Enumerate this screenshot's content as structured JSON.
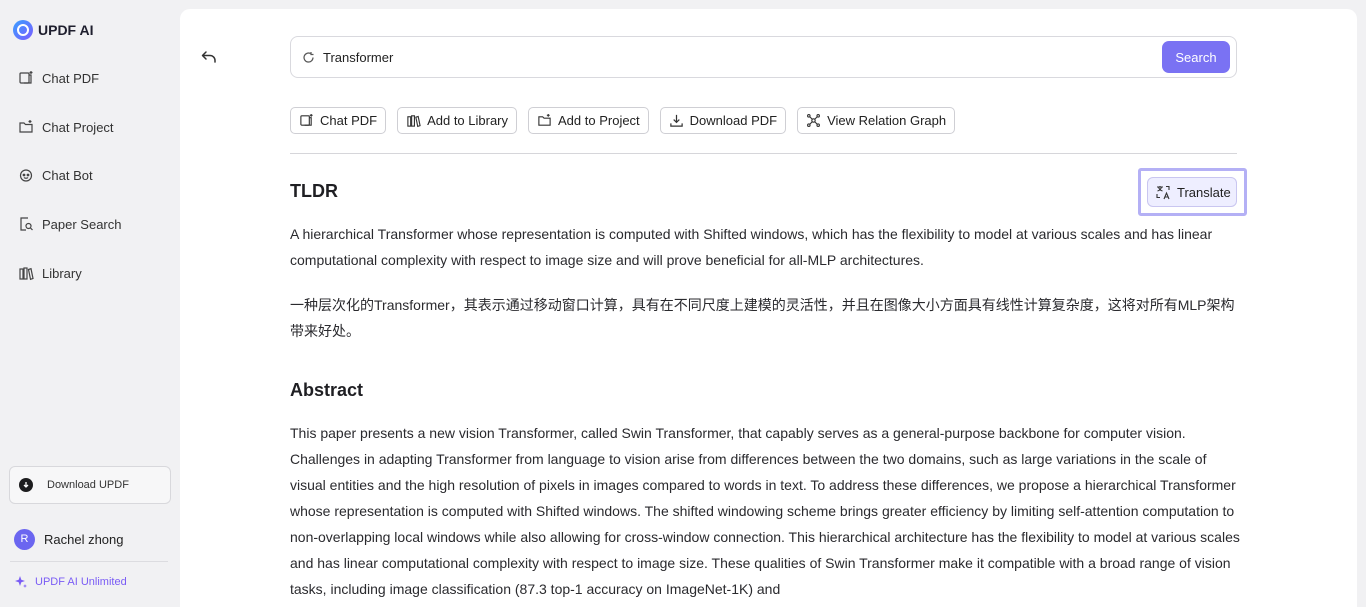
{
  "brand": {
    "name": "UPDF AI"
  },
  "sidebar": {
    "items": [
      {
        "label": "Chat PDF",
        "icon": "chat-pdf-icon"
      },
      {
        "label": "Chat Project",
        "icon": "folder-icon"
      },
      {
        "label": "Chat Bot",
        "icon": "bot-icon"
      },
      {
        "label": "Paper Search",
        "icon": "paper-search-icon"
      },
      {
        "label": "Library",
        "icon": "library-icon"
      }
    ],
    "download_label": "Download UPDF",
    "user": {
      "initial": "R",
      "name": "Rachel zhong"
    },
    "plan_label": "UPDF AI Unlimited"
  },
  "search": {
    "value": "Transformer",
    "button_label": "Search"
  },
  "actions": [
    {
      "label": "Chat PDF",
      "icon": "chat-pdf-icon"
    },
    {
      "label": "Add to Library",
      "icon": "library-icon"
    },
    {
      "label": "Add to Project",
      "icon": "folder-icon"
    },
    {
      "label": "Download PDF",
      "icon": "download-icon"
    },
    {
      "label": "View Relation Graph",
      "icon": "graph-icon"
    }
  ],
  "tldr": {
    "heading": "TLDR",
    "translate_label": "Translate",
    "text_en": "A hierarchical Transformer whose representation is computed with Shifted windows, which has the flexibility to model at various scales and has linear computational complexity with respect to image size and will prove beneficial for all-MLP architectures.",
    "text_zh": "一种层次化的Transformer，其表示通过移动窗口计算，具有在不同尺度上建模的灵活性，并且在图像大小方面具有线性计算复杂度，这将对所有MLP架构带来好处。"
  },
  "abstract": {
    "heading": "Abstract",
    "text": "This paper presents a new vision Transformer, called Swin Transformer, that capably serves as a general-purpose backbone for computer vision. Challenges in adapting Transformer from language to vision arise from differences between the two domains, such as large variations in the scale of visual entities and the high resolution of pixels in images compared to words in text. To address these differences, we propose a hierarchical Transformer whose representation is computed with Shifted windows. The shifted windowing scheme brings greater efficiency by limiting self-attention computation to non-overlapping local windows while also allowing for cross-window connection. This hierarchical architecture has the flexibility to model at various scales and has linear computational complexity with respect to image size. These qualities of Swin Transformer make it compatible with a broad range of vision tasks, including image classification (87.3 top-1 accuracy on ImageNet-1K) and"
  },
  "colors": {
    "accent": "#7a72f3",
    "highlight": "#b4b0f5"
  }
}
